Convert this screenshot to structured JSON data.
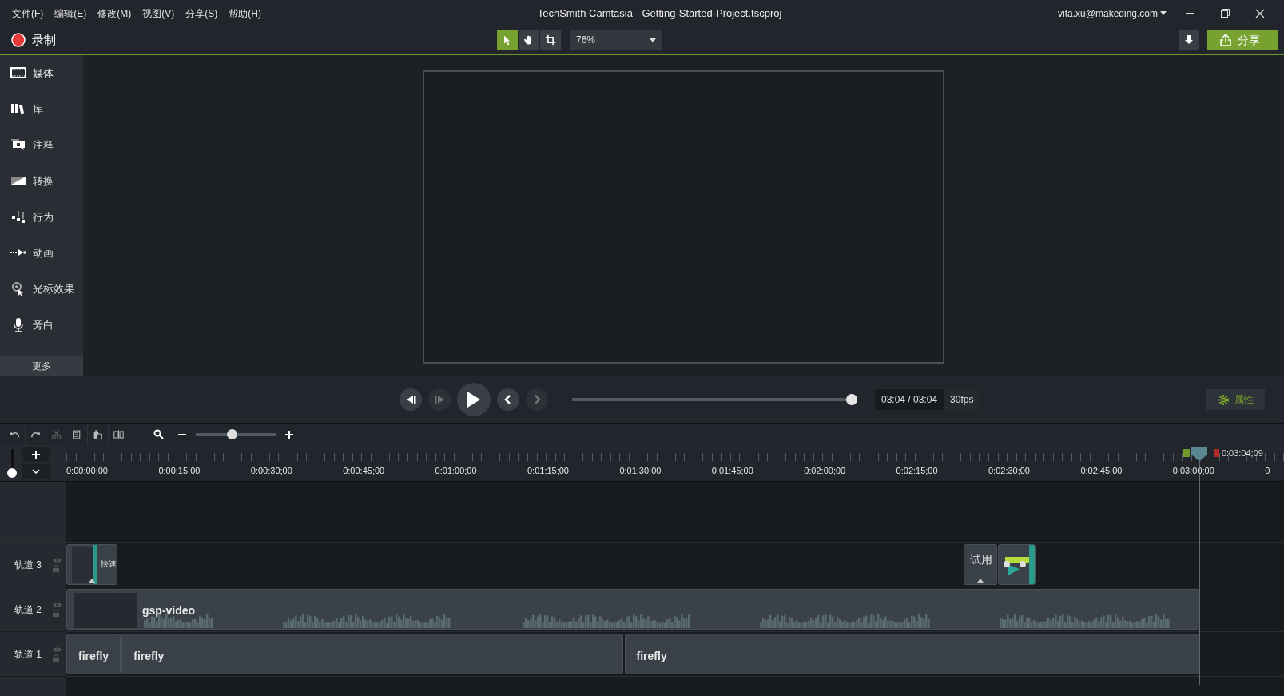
{
  "menu": [
    "文件(F)",
    "编辑(E)",
    "修改(M)",
    "视图(V)",
    "分享(S)",
    "帮助(H)"
  ],
  "window": {
    "title": "TechSmith Camtasia - Getting-Started-Project.tscproj",
    "account": "vita.xu@makeding.com"
  },
  "toolbar": {
    "record": "录制",
    "tools": [
      {
        "kind": "select",
        "selected": true
      },
      {
        "kind": "pan",
        "selected": false
      },
      {
        "kind": "crop",
        "selected": false
      }
    ],
    "zoom": "76%",
    "share": "分享"
  },
  "sidebar": {
    "items": [
      {
        "kind": "media",
        "label": "媒体"
      },
      {
        "kind": "library",
        "label": "库"
      },
      {
        "kind": "annotations",
        "label": "注释"
      },
      {
        "kind": "transitions",
        "label": "转换"
      },
      {
        "kind": "behaviors",
        "label": "行为"
      },
      {
        "kind": "animations",
        "label": "动画"
      },
      {
        "kind": "cursor",
        "label": "光标效果"
      },
      {
        "kind": "narration",
        "label": "旁白"
      }
    ],
    "more": "更多"
  },
  "playback": {
    "buttons": [
      {
        "kind": "step-back",
        "disabled": false
      },
      {
        "kind": "step-forward",
        "disabled": true
      },
      {
        "kind": "play",
        "disabled": false
      },
      {
        "kind": "previous",
        "disabled": false
      },
      {
        "kind": "next",
        "disabled": true
      }
    ],
    "level": 1,
    "time": "03:04 / 03:04",
    "fps": "30fps",
    "properties": "属性"
  },
  "timeline": {
    "tools": [
      {
        "kind": "undo",
        "disabled": false
      },
      {
        "kind": "redo",
        "disabled": false
      },
      {
        "kind": "cut",
        "disabled": true
      },
      {
        "kind": "copy",
        "disabled": false
      },
      {
        "kind": "paste",
        "disabled": false
      },
      {
        "kind": "split",
        "disabled": false
      }
    ],
    "zoom": {
      "level": 0.45
    },
    "track_height": {
      "level": 0
    },
    "ruler": [
      "0:00:00;00",
      "0:00:15;00",
      "0:00:30;00",
      "0:00:45;00",
      "0:01:00;00",
      "0:01:15;00",
      "0:01:30;00",
      "0:01:45;00",
      "0:02:00;00",
      "0:02:15;00",
      "0:02:30;00",
      "0:02:45;00",
      "0:03:00;00",
      "0"
    ],
    "playhead": "0:03:04;09",
    "tracks": [
      {
        "name": "轨道 3",
        "clips": [
          {
            "kind": "callout",
            "label": "快速"
          },
          {
            "kind": "callout",
            "label": "试用"
          },
          {
            "kind": "animation"
          }
        ]
      },
      {
        "name": "轨道 2",
        "clips": [
          {
            "kind": "video",
            "label": "gsp-video"
          }
        ]
      },
      {
        "name": "轨道 1",
        "clips": [
          {
            "kind": "audio",
            "label": "firefly"
          },
          {
            "kind": "audio",
            "label": "firefly"
          },
          {
            "kind": "audio",
            "label": "firefly"
          }
        ]
      }
    ]
  }
}
